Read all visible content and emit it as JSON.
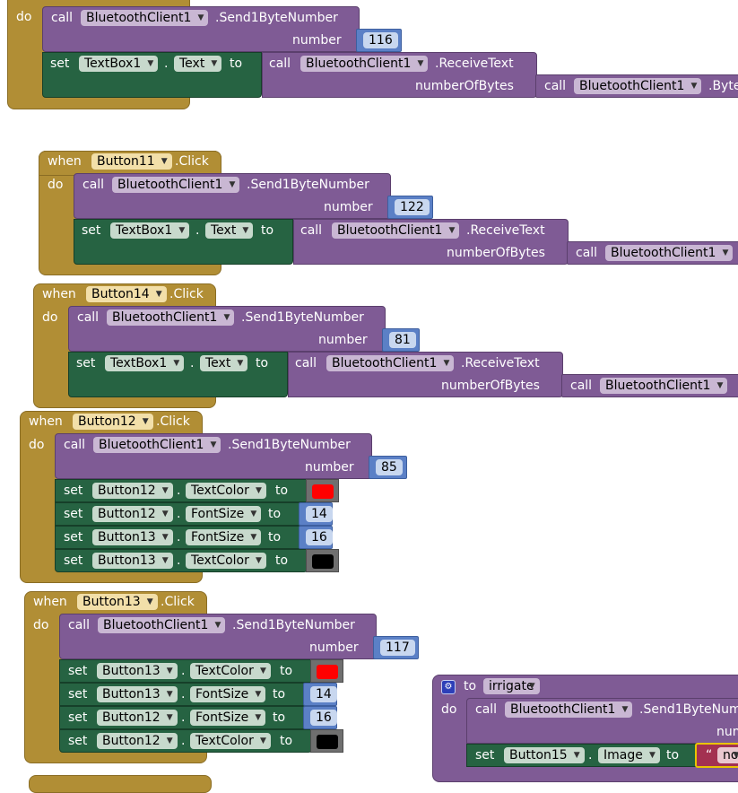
{
  "keywords": {
    "when": "when",
    "do": "do",
    "call": "call",
    "set": "set",
    "to": "to",
    "number": "number",
    "numberOfBytes": "numberOfBytes",
    "dot": "."
  },
  "method": {
    "send": ".Send1ByteNumber",
    "receive": ".ReceiveText",
    "bytes": ".Byte",
    "click": ".Click"
  },
  "components": {
    "bt": "BluetoothClient1",
    "tb": "TextBox1",
    "b11": "Button11",
    "b12": "Button12",
    "b13": "Button13",
    "b14": "Button14",
    "b15": "Button15"
  },
  "properties": {
    "text": "Text",
    "textcolor": "TextColor",
    "fontsize": "FontSize",
    "image": "Image"
  },
  "values": {
    "n116": "116",
    "n122": "122",
    "n81": "81",
    "n85": "85",
    "n14": "14",
    "n16": "16",
    "n117": "117"
  },
  "procedure": {
    "to": "to",
    "name": "irrigate",
    "text_quote": "“",
    "text_value": "no"
  },
  "colors": {
    "event": "#b18e35",
    "component": "#7f5b95",
    "setter": "#266342",
    "math": "#5b80c6",
    "red": "#ff0000",
    "black": "#000000",
    "text": "#a33151"
  }
}
